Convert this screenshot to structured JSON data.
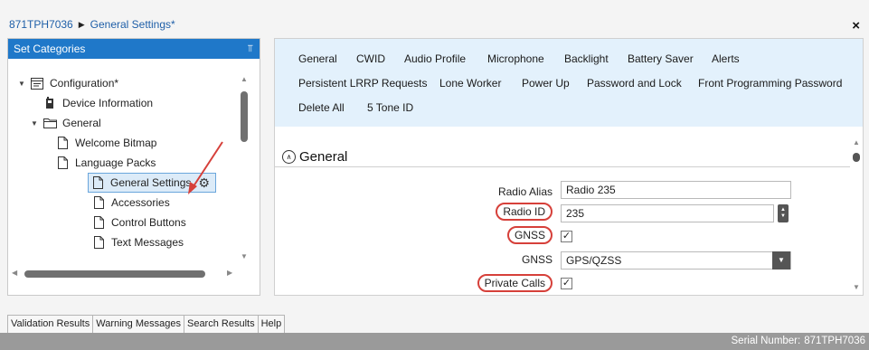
{
  "header": {
    "breadcrumb_device": "871TPH7036",
    "breadcrumb_separator": "▶",
    "breadcrumb_page": "General Settings*",
    "close_glyph": "×",
    "close_icon": "close-icon"
  },
  "left_panel": {
    "title": "Set Categories",
    "pin_glyph": "⫪",
    "pin_icon": "pin-icon",
    "tree": [
      {
        "label": "Configuration*",
        "icon": "config-icon",
        "expander": "▼"
      },
      {
        "label": "Device Information",
        "icon": "device-icon"
      },
      {
        "label": "General",
        "icon": "folder-icon",
        "expander": "▼"
      },
      {
        "label": "Welcome Bitmap",
        "icon": "document-icon"
      },
      {
        "label": "Language Packs",
        "icon": "document-icon"
      },
      {
        "label": "General Settings",
        "icon": "document-icon",
        "selected": true,
        "gear_glyph": "⚙"
      },
      {
        "label": "Accessories",
        "icon": "document-icon"
      },
      {
        "label": "Control Buttons",
        "icon": "document-icon"
      },
      {
        "label": "Text Messages",
        "icon": "document-icon"
      }
    ],
    "scroll_arrows": {
      "up": "▲",
      "down": "▼",
      "left": "◀",
      "right": "▶"
    }
  },
  "right_panel": {
    "tabs": [
      "General",
      "CWID",
      "Audio Profile",
      "Microphone",
      "Backlight",
      "Battery Saver",
      "Alerts",
      "Persistent LRRP Requests",
      "Lone Worker",
      "Power Up",
      "Password and Lock",
      "Front Programming Password",
      "Delete All",
      "5 Tone ID"
    ],
    "section": {
      "collapse_glyph": "∧",
      "title": "General"
    },
    "fields": {
      "radio_alias_label": "Radio Alias",
      "radio_alias_value": "Radio 235",
      "radio_id_label": "Radio ID",
      "radio_id_value": "235",
      "stepper_up": "▲",
      "stepper_down": "▼",
      "gnss_check_label": "GNSS",
      "gnss_check_mark": "✓",
      "gnss_select_label": "GNSS",
      "gnss_select_value": "GPS/QZSS",
      "select_arrow": "▼",
      "private_calls_label": "Private Calls",
      "private_calls_mark": "✓"
    },
    "scroll_arrows": {
      "up": "▲",
      "down": "▼"
    }
  },
  "bottom_tabs": [
    "Validation Results",
    "Warning Messages",
    "Search Results",
    "Help"
  ],
  "status": {
    "serial_label": "Serial Number:",
    "serial_value": "871TPH7036"
  },
  "colors": {
    "accent": "#1f78c9",
    "tab_strip": "#e3f1fc",
    "annotation": "#d6403a",
    "status_bar": "#9a9a9a"
  }
}
